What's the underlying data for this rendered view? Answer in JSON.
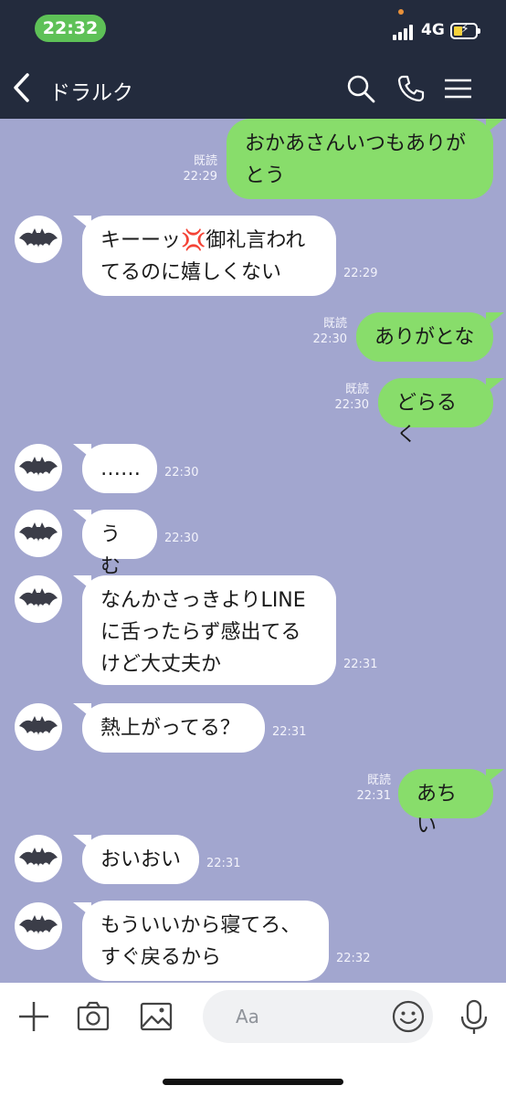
{
  "status": {
    "time": "22:32",
    "network": "4G",
    "colors": {
      "pill": "#5ec157",
      "battery": "#f6d23a"
    }
  },
  "header": {
    "title": "ドラルク",
    "icons": [
      "back-chevron-icon",
      "search-icon",
      "phone-icon",
      "menu-icon"
    ]
  },
  "messages": [
    {
      "side": "me",
      "text": "おかあさんいつもありが\nとう",
      "read": "既読",
      "time": "22:29"
    },
    {
      "side": "them",
      "text": "キーーッ💢御礼言われ\nてるのに嬉しくない",
      "time": "22:29"
    },
    {
      "side": "me",
      "text": "ありがとな",
      "read": "既読",
      "time": "22:30"
    },
    {
      "side": "me",
      "text": "どらるく",
      "read": "既読",
      "time": "22:30"
    },
    {
      "side": "them",
      "text": "……",
      "time": "22:30"
    },
    {
      "side": "them",
      "text": "うむ",
      "time": "22:30"
    },
    {
      "side": "them",
      "text": "なんかさっきよりLINE\nに舌ったらず感出てる\nけど大丈夫か",
      "time": "22:31"
    },
    {
      "side": "them",
      "text": "熱上がってる？",
      "time": "22:31"
    },
    {
      "side": "me",
      "text": "あちい",
      "read": "既読",
      "time": "22:31"
    },
    {
      "side": "them",
      "text": "おいおい",
      "time": "22:31"
    },
    {
      "side": "them",
      "text": "もういいから寝てろ、\nすぐ戻るから",
      "time": "22:32"
    }
  ],
  "input": {
    "placeholder": "Aa",
    "icons": [
      "plus-icon",
      "camera-icon",
      "image-icon",
      "emoji-icon",
      "mic-icon"
    ]
  },
  "colors": {
    "chat_bg": "#a2a6cf",
    "my_bubble": "#88dd6b",
    "their_bubble": "#ffffff",
    "header": "#232b3d"
  }
}
